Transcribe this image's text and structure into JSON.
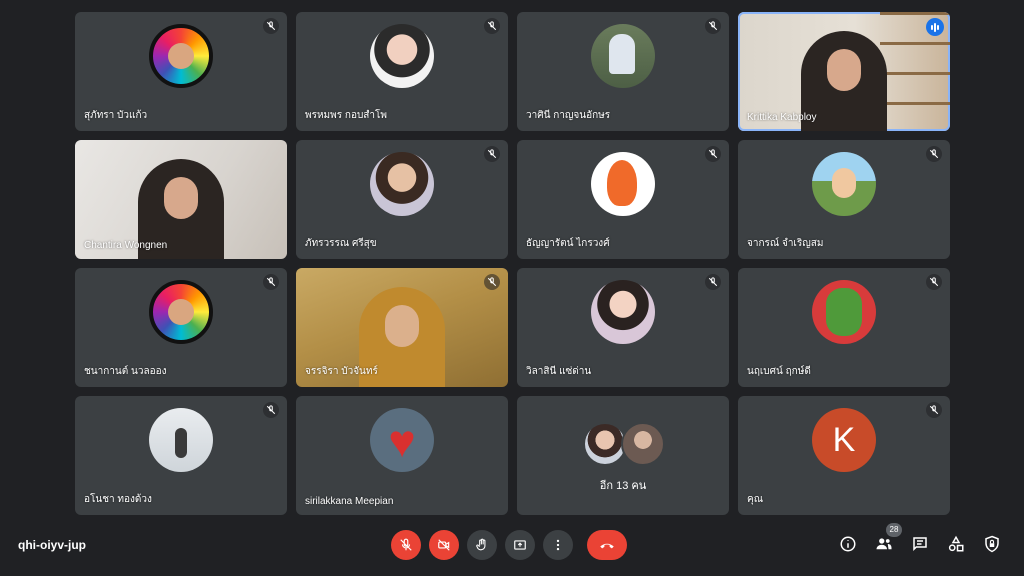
{
  "meeting": {
    "code": "qhi-oiyv-jup",
    "participant_count": "28",
    "more_participants_label": "อีก 13 คน"
  },
  "participants": [
    {
      "name": "สุภัทรา บัวแก้ว"
    },
    {
      "name": "พรหมพร กอบสำโพ"
    },
    {
      "name": "วาศินี กาญจนอักษร"
    },
    {
      "name": "Krittika Kabploy"
    },
    {
      "name": "Chantira Wongnen"
    },
    {
      "name": "ภัทรวรรณ ศรีสุข"
    },
    {
      "name": "ธัญญารัตน์ ไกรวงศ์"
    },
    {
      "name": "จากรณ์ จำเริญสม"
    },
    {
      "name": "ชนากานต์ นวลออง"
    },
    {
      "name": "จรรจิรา บัวจันทร์"
    },
    {
      "name": "วิลาสินี แซ่ด่าน"
    },
    {
      "name": "นฤเบศน์ ฤกษ์ดี"
    },
    {
      "name": "อโนชา ทองด้วง"
    },
    {
      "name": "sirilakkana Meepian"
    },
    {
      "name": "คุณ",
      "initial": "K"
    }
  ],
  "colors": {
    "background": "#202124",
    "tile": "#3c4043",
    "accent": "#1a73e8",
    "danger": "#ea4335"
  },
  "icons": [
    "mic-off-icon",
    "camera-off-icon",
    "raise-hand-icon",
    "present-screen-icon",
    "more-options-icon",
    "end-call-icon",
    "info-icon",
    "people-icon",
    "chat-icon",
    "activities-icon",
    "host-controls-icon"
  ]
}
